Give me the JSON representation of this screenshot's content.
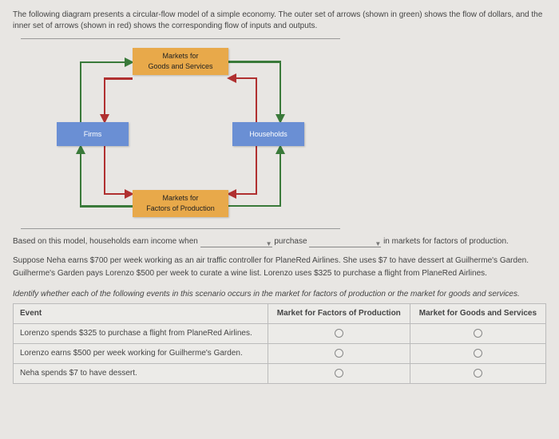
{
  "intro": "The following diagram presents a circular-flow model of a simple economy. The outer set of arrows (shown in green) shows the flow of dollars, and the inner set of arrows (shown in red) shows the corresponding flow of inputs and outputs.",
  "diagram": {
    "markets_goods": "Markets for\nGoods and Services",
    "markets_factors": "Markets for\nFactors of Production",
    "firms": "Firms",
    "households": "Households"
  },
  "question": {
    "prefix": "Based on this model, households earn income when",
    "mid": "purchase",
    "suffix": "in markets for factors of production."
  },
  "scenario": {
    "line1": "Suppose Neha earns $700 per week working as an air traffic controller for PlaneRed Airlines. She uses $7 to have dessert at Guilherme's Garden.",
    "line2": "Guilherme's Garden pays Lorenzo $500 per week to curate a wine list. Lorenzo uses $325 to purchase a flight from PlaneRed Airlines."
  },
  "identify_prompt": "Identify whether each of the following events in this scenario occurs in the market for factors of production or the market for goods and services.",
  "table": {
    "headers": {
      "event": "Event",
      "factors": "Market for Factors of Production",
      "goods": "Market for Goods and Services"
    },
    "rows": [
      {
        "event": "Lorenzo spends $325 to purchase a flight from PlaneRed Airlines."
      },
      {
        "event": "Lorenzo earns $500 per week working for Guilherme's Garden."
      },
      {
        "event": "Neha spends $7 to have dessert."
      }
    ]
  }
}
